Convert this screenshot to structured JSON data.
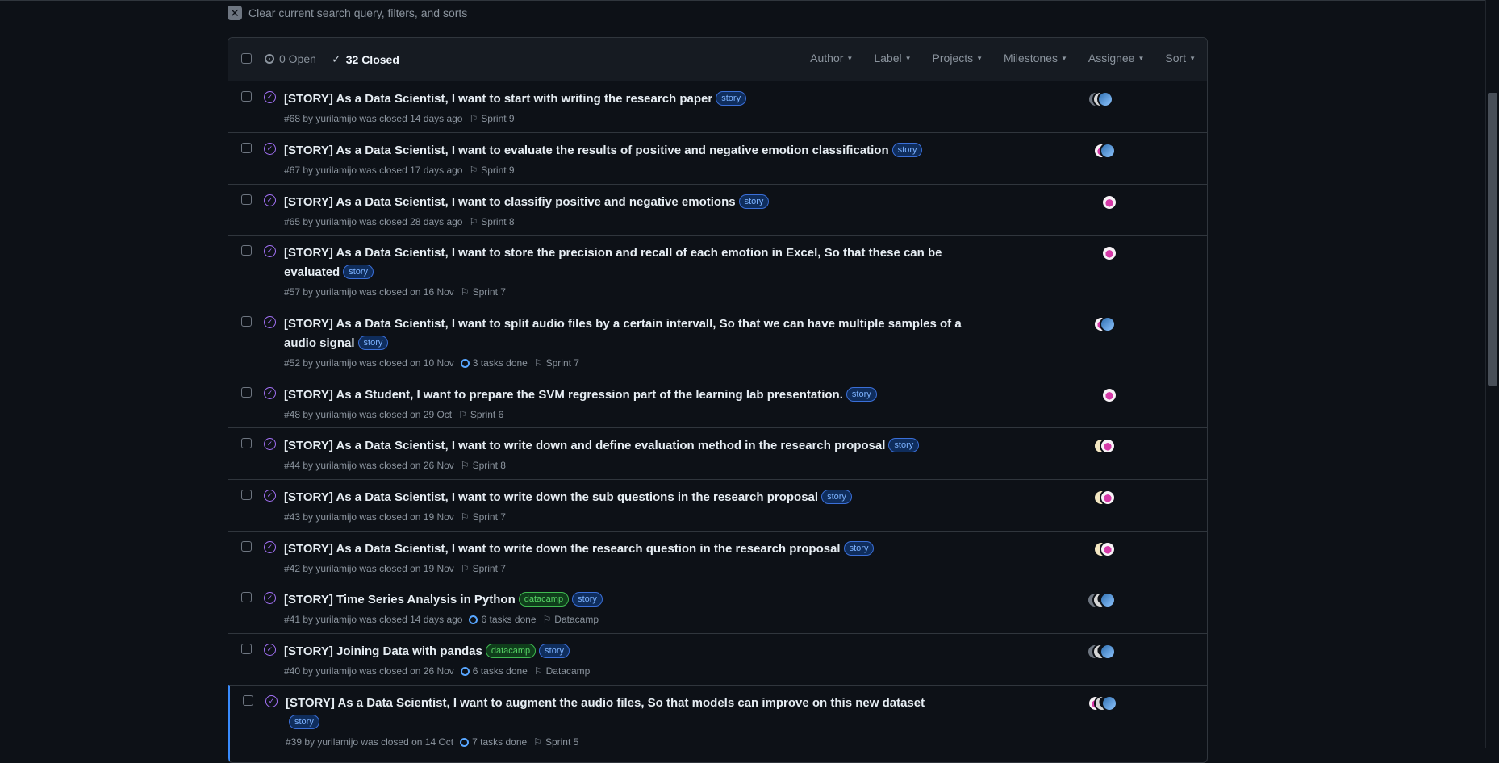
{
  "clear_search": {
    "label": "Clear current search query, filters, and sorts"
  },
  "header": {
    "open_label": "0 Open",
    "closed_label": "32 Closed",
    "filters": [
      "Author",
      "Label",
      "Projects",
      "Milestones",
      "Assignee",
      "Sort"
    ]
  },
  "issues": [
    {
      "title": "[STORY] As a Data Scientist, I want to start with writing the research paper",
      "labels": [
        "story"
      ],
      "number": "#68",
      "by": "by yurilamijo was closed 14 days ago",
      "tasks": "",
      "milestone": "Sprint 9"
    },
    {
      "title": "[STORY] As a Data Scientist, I want to evaluate the results of positive and negative emotion classification",
      "labels": [
        "story"
      ],
      "number": "#67",
      "by": "by yurilamijo was closed 17 days ago",
      "tasks": "",
      "milestone": "Sprint 9"
    },
    {
      "title": "[STORY] As a Data Scientist, I want to classifiy positive and negative emotions",
      "labels": [
        "story"
      ],
      "number": "#65",
      "by": "by yurilamijo was closed 28 days ago",
      "tasks": "",
      "milestone": "Sprint 8"
    },
    {
      "title": "[STORY] As a Data Scientist, I want to store the precision and recall of each emotion in Excel, So that these can be evaluated",
      "labels": [
        "story"
      ],
      "number": "#57",
      "by": "by yurilamijo was closed on 16 Nov",
      "tasks": "",
      "milestone": "Sprint 7"
    },
    {
      "title": "[STORY] As a Data Scientist, I want to split audio files by a certain intervall, So that we can have multiple samples of a audio signal",
      "labels": [
        "story"
      ],
      "number": "#52",
      "by": "by yurilamijo was closed on 10 Nov",
      "tasks": "3 tasks done",
      "milestone": "Sprint 7"
    },
    {
      "title": "[STORY] As a Student, I want to prepare the SVM regression part of the learning lab presentation.",
      "labels": [
        "story"
      ],
      "number": "#48",
      "by": "by yurilamijo was closed on 29 Oct",
      "tasks": "",
      "milestone": "Sprint 6"
    },
    {
      "title": "[STORY] As a Data Scientist, I want to write down and define evaluation method in the research proposal",
      "labels": [
        "story"
      ],
      "number": "#44",
      "by": "by yurilamijo was closed on 26 Nov",
      "tasks": "",
      "milestone": "Sprint 8"
    },
    {
      "title": "[STORY] As a Data Scientist, I want to write down the sub questions in the research proposal",
      "labels": [
        "story"
      ],
      "number": "#43",
      "by": "by yurilamijo was closed on 19 Nov",
      "tasks": "",
      "milestone": "Sprint 7"
    },
    {
      "title": "[STORY] As a Data Scientist, I want to write down the research question in the research proposal",
      "labels": [
        "story"
      ],
      "number": "#42",
      "by": "by yurilamijo was closed on 19 Nov",
      "tasks": "",
      "milestone": "Sprint 7"
    },
    {
      "title": "[STORY] Time Series Analysis in Python",
      "labels": [
        "datacamp",
        "story"
      ],
      "number": "#41",
      "by": "by yurilamijo was closed 14 days ago",
      "tasks": "6 tasks done",
      "milestone": "Datacamp"
    },
    {
      "title": "[STORY] Joining Data with pandas",
      "labels": [
        "datacamp",
        "story"
      ],
      "number": "#40",
      "by": "by yurilamijo was closed on 26 Nov",
      "tasks": "6 tasks done",
      "milestone": "Datacamp"
    },
    {
      "title": "[STORY] As a Data Scientist, I want to augment the audio files, So that models can improve on this new dataset",
      "labels": [
        "story"
      ],
      "number": "#39",
      "by": "by yurilamijo was closed on 14 Oct",
      "tasks": "7 tasks done",
      "milestone": "Sprint 5"
    }
  ],
  "colors": {
    "closed_icon": "#a371f7",
    "story_label": "#1f6feb",
    "datacamp_label": "#3fb950",
    "background": "#0d1117"
  }
}
